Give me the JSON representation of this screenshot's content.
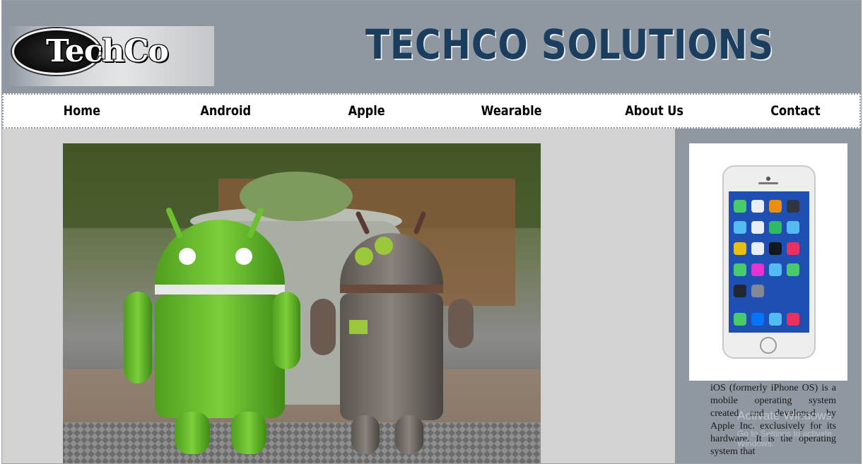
{
  "header": {
    "logo_text": "TechCo",
    "site_title": "TECHCO SOLUTIONS"
  },
  "nav": {
    "items": [
      "Home",
      "Android",
      "Apple",
      "Wearable",
      "About Us",
      "Contact"
    ]
  },
  "main": {
    "hero_image": "android-figures-photo"
  },
  "sidebar": {
    "image": "iphone-photo",
    "text": "iOS (formerly iPhone OS) is a mobile operating system created and developed by Apple Inc. exclusively for its hardware. It is the operating system that"
  },
  "overlay": {
    "watermark": "Activate Windows",
    "watermark_sub": "Go to Settings to activate Windows."
  }
}
